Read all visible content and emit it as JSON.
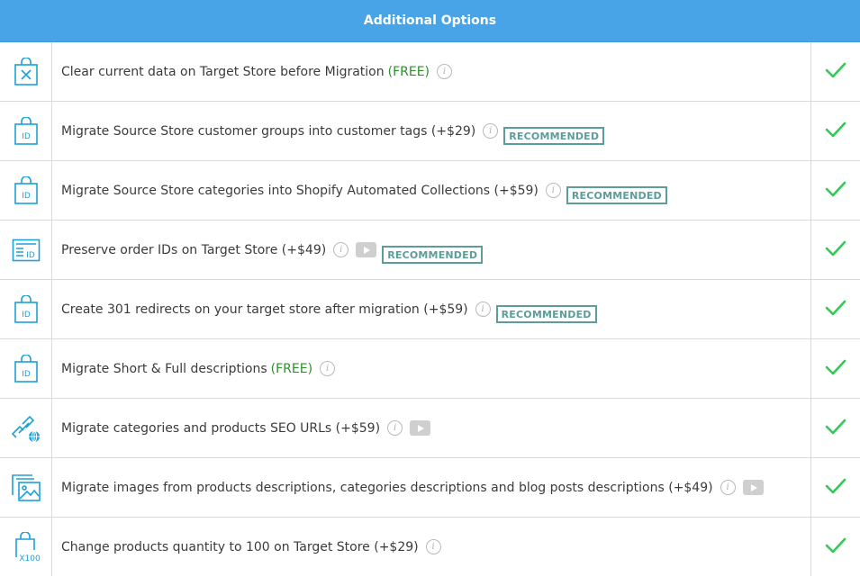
{
  "header": {
    "title": "Additional Options"
  },
  "colors": {
    "header_bg": "#49a3e7",
    "free": "#2f8d2f",
    "badge": "#5c9d9b",
    "check": "#2ecc55",
    "icon": "#1ea0d8"
  },
  "rows": [
    {
      "icon": "bag-x-icon",
      "text": "Clear current data on Target Store before Migration",
      "free": "(FREE)",
      "info": true,
      "video": false,
      "badge": "",
      "checked": true
    },
    {
      "icon": "bag-id-icon",
      "text": "Migrate Source Store customer groups into customer tags (+$29)",
      "free": "",
      "info": true,
      "video": false,
      "badge": "RECOMMENDED",
      "checked": true
    },
    {
      "icon": "bag-id-icon",
      "text": "Migrate Source Store categories into Shopify Automated Collections (+$59)",
      "free": "",
      "info": true,
      "video": false,
      "badge": "RECOMMENDED",
      "checked": true
    },
    {
      "icon": "order-id-icon",
      "text": "Preserve order IDs on Target Store (+$49)",
      "free": "",
      "info": true,
      "video": true,
      "badge": "RECOMMENDED",
      "checked": true
    },
    {
      "icon": "bag-id-icon",
      "text": "Create 301 redirects on your target store after migration (+$59)",
      "free": "",
      "info": true,
      "video": false,
      "badge": "RECOMMENDED",
      "checked": true
    },
    {
      "icon": "bag-id-icon",
      "text": "Migrate Short & Full descriptions",
      "free": "(FREE)",
      "info": true,
      "video": false,
      "badge": "",
      "checked": true
    },
    {
      "icon": "seo-link-icon",
      "text": "Migrate categories and products SEO URLs (+$59)",
      "free": "",
      "info": true,
      "video": true,
      "badge": "",
      "checked": true
    },
    {
      "icon": "images-icon",
      "text": "Migrate images from products descriptions, categories descriptions and blog posts descriptions (+$49)",
      "free": "",
      "info": true,
      "video": true,
      "badge": "",
      "checked": true
    },
    {
      "icon": "bag-x100-icon",
      "text": "Change products quantity to 100 on Target Store (+$29)",
      "free": "",
      "info": true,
      "video": false,
      "badge": "",
      "checked": true
    }
  ],
  "glyphs": {
    "info": "i",
    "id": "ID",
    "x100": "X100"
  }
}
